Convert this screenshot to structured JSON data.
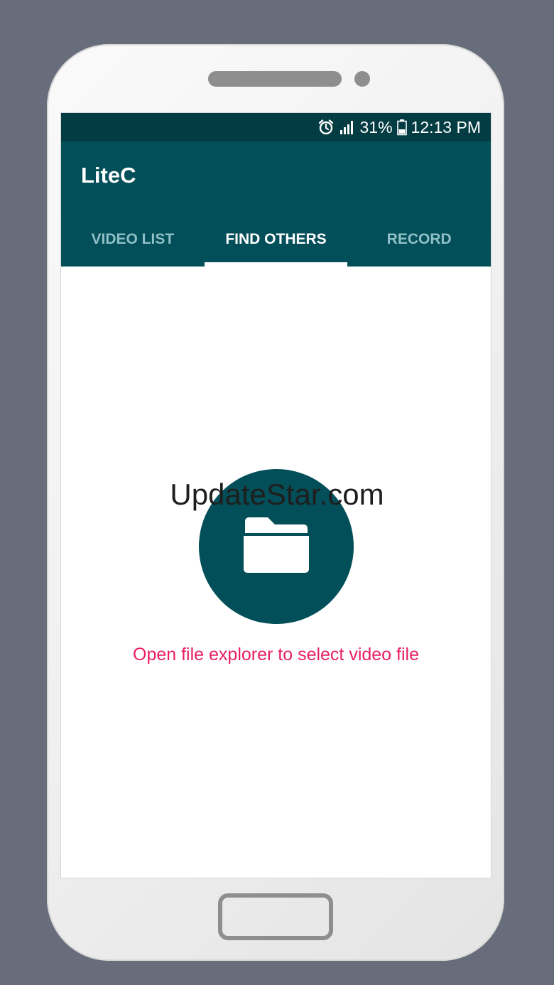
{
  "status_bar": {
    "battery": "31%",
    "time": "12:13 PM",
    "icons": [
      "alarm-icon",
      "signal-icon",
      "battery-icon"
    ]
  },
  "app": {
    "title": "LiteC"
  },
  "tabs": [
    {
      "label": "VIDEO LIST",
      "active": false
    },
    {
      "label": "FIND OTHERS",
      "active": true
    },
    {
      "label": "RECORD",
      "active": false
    }
  ],
  "content": {
    "button_icon": "folder-icon",
    "hint": "Open file explorer to select video file"
  },
  "watermark": "UpdateStar.com",
  "colors": {
    "primary": "#034f59",
    "primary_dark": "#043c43",
    "accent": "#e91e63",
    "tab_inactive": "#8fc0c6"
  }
}
